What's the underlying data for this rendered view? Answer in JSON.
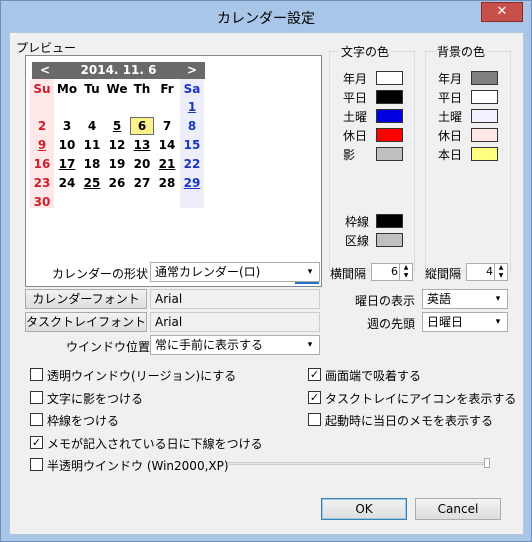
{
  "window": {
    "title": "カレンダー設定",
    "close_glyph": "✕"
  },
  "preview": {
    "label": "プレビュー",
    "month_title": "2014. 11. 6",
    "prev_glyph": "<",
    "next_glyph": ">",
    "weekdays": [
      "Su",
      "Mo",
      "Tu",
      "We",
      "Th",
      "Fr",
      "Sa"
    ],
    "days": [
      {
        "d": "1",
        "col": 6,
        "row": 0,
        "cls": "blue ul"
      },
      {
        "d": "2",
        "col": 0,
        "row": 1,
        "cls": "red"
      },
      {
        "d": "3",
        "col": 1,
        "row": 1,
        "cls": ""
      },
      {
        "d": "4",
        "col": 2,
        "row": 1,
        "cls": ""
      },
      {
        "d": "5",
        "col": 3,
        "row": 1,
        "cls": "ul"
      },
      {
        "d": "6",
        "col": 4,
        "row": 1,
        "cls": "today"
      },
      {
        "d": "7",
        "col": 5,
        "row": 1,
        "cls": ""
      },
      {
        "d": "8",
        "col": 6,
        "row": 1,
        "cls": "blue"
      },
      {
        "d": "9",
        "col": 0,
        "row": 2,
        "cls": "red ul"
      },
      {
        "d": "10",
        "col": 1,
        "row": 2,
        "cls": ""
      },
      {
        "d": "11",
        "col": 2,
        "row": 2,
        "cls": ""
      },
      {
        "d": "12",
        "col": 3,
        "row": 2,
        "cls": ""
      },
      {
        "d": "13",
        "col": 4,
        "row": 2,
        "cls": "ul"
      },
      {
        "d": "14",
        "col": 5,
        "row": 2,
        "cls": ""
      },
      {
        "d": "15",
        "col": 6,
        "row": 2,
        "cls": "blue"
      },
      {
        "d": "16",
        "col": 0,
        "row": 3,
        "cls": "red"
      },
      {
        "d": "17",
        "col": 1,
        "row": 3,
        "cls": "ul"
      },
      {
        "d": "18",
        "col": 2,
        "row": 3,
        "cls": ""
      },
      {
        "d": "19",
        "col": 3,
        "row": 3,
        "cls": ""
      },
      {
        "d": "20",
        "col": 4,
        "row": 3,
        "cls": ""
      },
      {
        "d": "21",
        "col": 5,
        "row": 3,
        "cls": "ul"
      },
      {
        "d": "22",
        "col": 6,
        "row": 3,
        "cls": "blue"
      },
      {
        "d": "23",
        "col": 0,
        "row": 4,
        "cls": "red"
      },
      {
        "d": "24",
        "col": 1,
        "row": 4,
        "cls": ""
      },
      {
        "d": "25",
        "col": 2,
        "row": 4,
        "cls": "ul"
      },
      {
        "d": "26",
        "col": 3,
        "row": 4,
        "cls": ""
      },
      {
        "d": "27",
        "col": 4,
        "row": 4,
        "cls": ""
      },
      {
        "d": "28",
        "col": 5,
        "row": 4,
        "cls": ""
      },
      {
        "d": "29",
        "col": 6,
        "row": 4,
        "cls": "blue ul"
      },
      {
        "d": "30",
        "col": 0,
        "row": 5,
        "cls": "red"
      }
    ],
    "mini_icon_day": "6"
  },
  "text_colors": {
    "label": "文字の色",
    "items": [
      {
        "label": "年月",
        "color": "#ffffff"
      },
      {
        "label": "平日",
        "color": "#000000"
      },
      {
        "label": "土曜",
        "color": "#0000e0"
      },
      {
        "label": "休日",
        "color": "#ff0000"
      },
      {
        "label": "影",
        "color": "#c0c0c0"
      }
    ],
    "extra": [
      {
        "label": "枠線",
        "color": "#000000"
      },
      {
        "label": "区線",
        "color": "#c0c0c0"
      }
    ]
  },
  "bg_colors": {
    "label": "背景の色",
    "items": [
      {
        "label": "年月",
        "color": "#808080"
      },
      {
        "label": "平日",
        "color": "#ffffff"
      },
      {
        "label": "土曜",
        "color": "#f0f0ff"
      },
      {
        "label": "休日",
        "color": "#ffe8e8"
      },
      {
        "label": "本日",
        "color": "#ffff80"
      }
    ]
  },
  "settings": {
    "shape_label": "カレンダーの形状",
    "shape_value": "通常カレンダー(ロ)",
    "h_spacing_label": "横間隔",
    "h_spacing_value": "6",
    "v_spacing_label": "縦間隔",
    "v_spacing_value": "4",
    "calendar_font_btn": "カレンダーフォント",
    "calendar_font_value": "Arial",
    "tasktray_font_btn": "タスクトレイフォント",
    "tasktray_font_value": "Arial",
    "weekday_display_label": "曜日の表示",
    "weekday_display_value": "英語",
    "week_start_label": "週の先頭",
    "week_start_value": "日曜日",
    "window_pos_label": "ウインドウ位置",
    "window_pos_value": "常に手前に表示する"
  },
  "checkboxes_left": [
    {
      "label": "透明ウインドウ(リージョン)にする",
      "checked": false
    },
    {
      "label": "文字に影をつける",
      "checked": false
    },
    {
      "label": "枠線をつける",
      "checked": false
    },
    {
      "label": "メモが記入されている日に下線をつける",
      "checked": true
    },
    {
      "label": "半透明ウインドウ (Win2000,XP)",
      "checked": false
    }
  ],
  "checkboxes_right": [
    {
      "label": "画面端で吸着する",
      "checked": true
    },
    {
      "label": "タスクトレイにアイコンを表示する",
      "checked": true
    },
    {
      "label": "起動時に当日のメモを表示する",
      "checked": false
    }
  ],
  "buttons": {
    "ok": "OK",
    "cancel": "Cancel"
  },
  "glyphs": {
    "check": "✓",
    "dropdown": "▾",
    "up": "▲",
    "down": "▼"
  }
}
